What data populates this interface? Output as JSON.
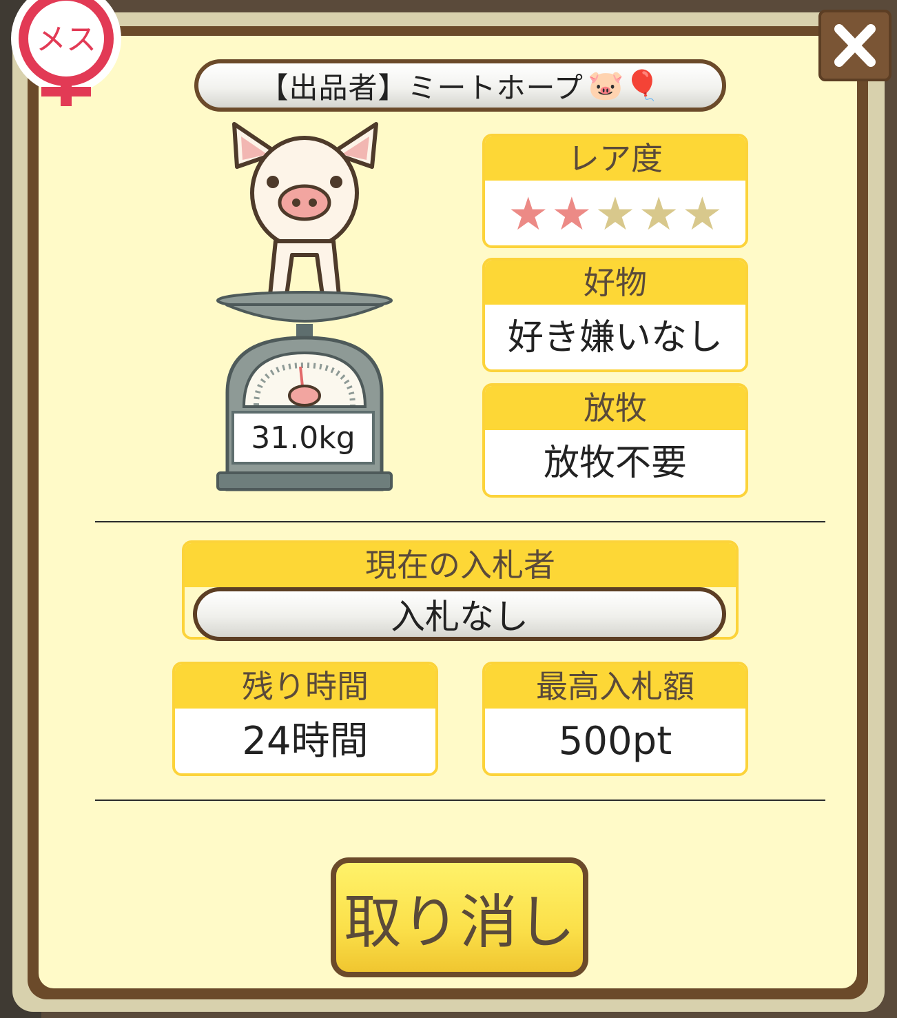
{
  "badge": {
    "label": "メス",
    "icon": "female-symbol-icon",
    "color": "#e23a55"
  },
  "close": {
    "icon": "close-icon"
  },
  "seller": {
    "label": "【出品者】ミートホープ",
    "emoji": "🐷🎈"
  },
  "pig": {
    "weight": "31.0kg",
    "icon": "pig-on-scale-icon"
  },
  "rarity": {
    "title": "レア度",
    "stars_filled": 2,
    "stars_total": 5,
    "filled_color": "#ec8a86",
    "empty_color": "#d8c88c"
  },
  "favorite": {
    "title": "好物",
    "value": "好き嫌いなし"
  },
  "grazing": {
    "title": "放牧",
    "value": "放牧不要"
  },
  "bidder": {
    "title": "現在の入札者",
    "value": "入札なし"
  },
  "remaining": {
    "title": "残り時間",
    "value": "24時間"
  },
  "highest_bid": {
    "title": "最高入札額",
    "value": "500pt"
  },
  "cancel_button": {
    "label": "取り消し"
  },
  "colors": {
    "panel": "#fffac8",
    "frame": "#6b4a2a",
    "header_yellow": "#fdd736"
  }
}
